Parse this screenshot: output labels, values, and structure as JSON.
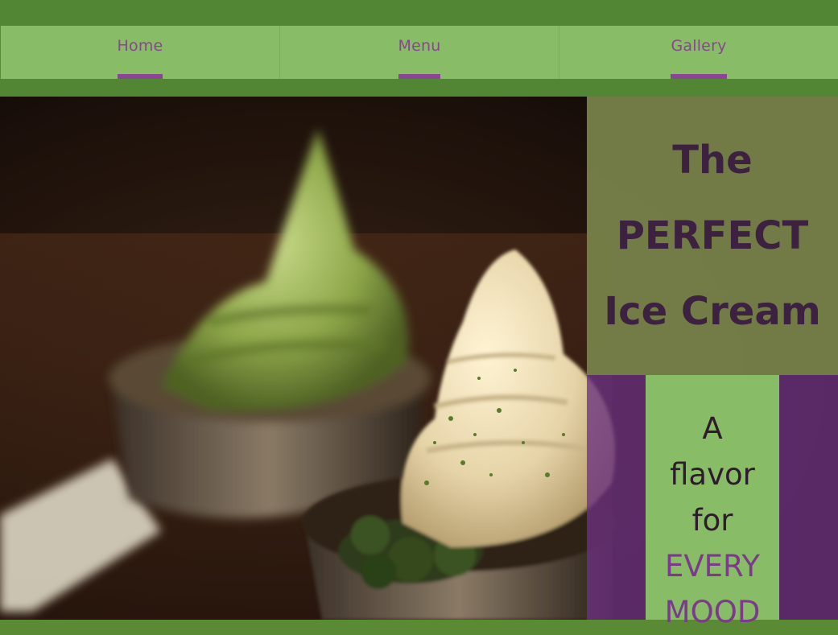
{
  "nav": {
    "items": [
      {
        "label": "Home"
      },
      {
        "label": "Menu"
      },
      {
        "label": "Gallery"
      }
    ]
  },
  "hero": {
    "title_lines": [
      "The",
      "PERFECT",
      "Ice Cream"
    ],
    "tagline_lines": [
      "A",
      "flavor",
      "for",
      "EVERY",
      "MOOD"
    ]
  },
  "colors": {
    "top_bar": "#528634",
    "nav_background": "#88bc66",
    "nav_link": "#8a4593",
    "title_panel": "#767f48",
    "title_text": "#3c2141",
    "purple_panel": "#6c3280",
    "tagline_box": "#88bc66",
    "tagline_accent": "#7b3a8c"
  }
}
